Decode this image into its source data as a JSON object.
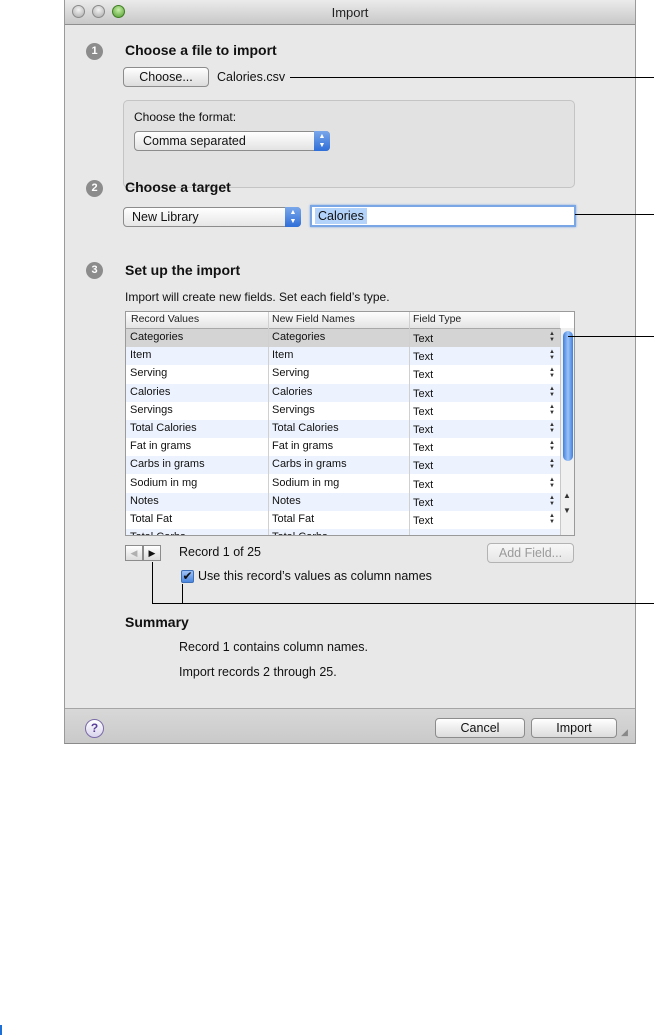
{
  "window": {
    "title": "Import"
  },
  "step1": {
    "number": "1",
    "heading": "Choose a file to import",
    "choose_button": "Choose...",
    "filename": "Calories.csv",
    "format_label": "Choose the format:",
    "format_value": "Comma separated"
  },
  "step2": {
    "number": "2",
    "heading": "Choose a target",
    "target_value": "New Library",
    "name_value": "Calories"
  },
  "step3": {
    "number": "3",
    "heading": "Set up the import",
    "instructions": "Import will create new fields. Set each field’s type.",
    "table": {
      "headers": [
        "Record Values",
        "New Field Names",
        "Field Type"
      ],
      "rows": [
        {
          "record": "Categories",
          "field": "Categories",
          "type": "Text"
        },
        {
          "record": "Item",
          "field": "Item",
          "type": "Text"
        },
        {
          "record": "Serving",
          "field": "Serving",
          "type": "Text"
        },
        {
          "record": "Calories",
          "field": "Calories",
          "type": "Text"
        },
        {
          "record": "Servings",
          "field": "Servings",
          "type": "Text"
        },
        {
          "record": "Total Calories",
          "field": "Total Calories",
          "type": "Text"
        },
        {
          "record": "Fat in grams",
          "field": "Fat in grams",
          "type": "Text"
        },
        {
          "record": "Carbs in grams",
          "field": "Carbs in grams",
          "type": "Text"
        },
        {
          "record": "Sodium in mg",
          "field": "Sodium in mg",
          "type": "Text"
        },
        {
          "record": "Notes",
          "field": "Notes",
          "type": "Text"
        },
        {
          "record": "Total Fat",
          "field": "Total Fat",
          "type": "Text"
        }
      ],
      "partial_row": {
        "record": "Total Carbs",
        "field": "Total Carbs"
      }
    },
    "record_status": "Record 1 of 25",
    "add_field_button": "Add Field...",
    "checkbox_label": "Use this record’s values as column names",
    "checkbox_checked": true
  },
  "summary": {
    "heading": "Summary",
    "line1": "Record 1 contains column names.",
    "line2": "Import records 2 through 25."
  },
  "footer": {
    "help_label": "?",
    "cancel_button": "Cancel",
    "import_button": "Import"
  },
  "icons": {
    "prev": "◀",
    "next": "▶",
    "popup": "up-down-arrows",
    "check": "✔"
  }
}
